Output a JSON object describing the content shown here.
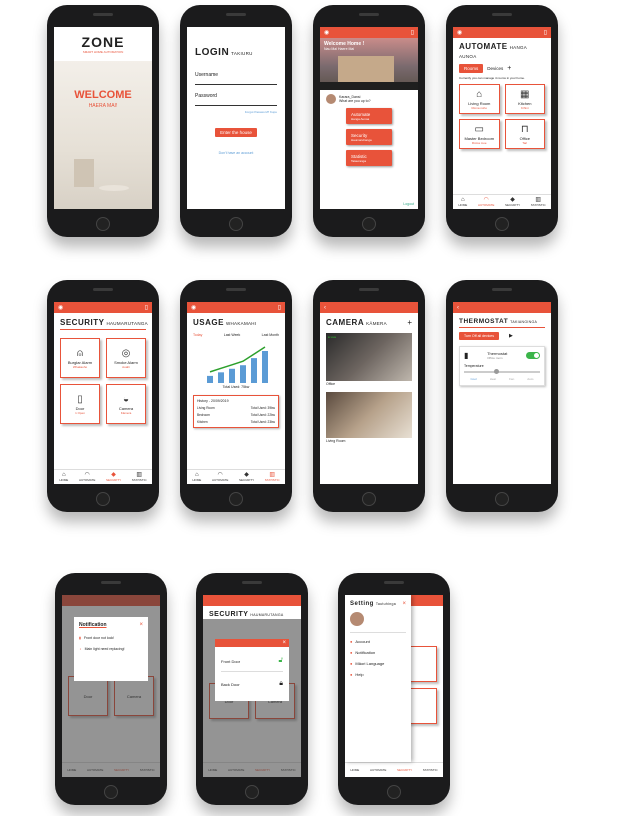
{
  "colors": {
    "accent": "#e8533a",
    "phone": "#1b1b1c"
  },
  "welcome": {
    "logo": "ZONE",
    "logo_sub": "SMART HOME AUTOMATION",
    "title": "WELCOME",
    "subtitle": "HAERA MAI!"
  },
  "login": {
    "title": "LOGIN",
    "title_sub": "TAKIURU",
    "username_label": "Username",
    "password_label": "Password",
    "forgot": "Forgot Password? Kupu",
    "enter_button": "Enter the house",
    "no_account": "Don't have an account"
  },
  "home": {
    "banner_title": "Welcome Home !",
    "banner_sub": "Nau Mai Haere Mai",
    "stats": [
      "",
      "",
      "",
      ""
    ],
    "user_name": "Karara_Dansi",
    "user_msg": "What are you up to?",
    "buttons": [
      {
        "label": "Automate",
        "sub": "Hanga Aunoa"
      },
      {
        "label": "Security",
        "sub": "Haumaruhanga"
      },
      {
        "label": "Statistic",
        "sub": "Tatauranga"
      }
    ],
    "logout": "Logout"
  },
  "automate": {
    "title": "AUTOMATE",
    "title_sub": "HANGA AUNOA",
    "tab_rooms": "Rooms",
    "tab_devices": "Devices",
    "add": "+",
    "desc": "Currently you can manage 4 rooms in your home.",
    "rooms": [
      {
        "name": "Living Room",
        "sub": "Rūma noho",
        "icon": "sofa-icon"
      },
      {
        "name": "Kitchen",
        "sub": "Kīhini",
        "icon": "kitchen-icon"
      },
      {
        "name": "Master Bedroom",
        "sub": "Rūma moe",
        "icon": "bed-icon"
      },
      {
        "name": "Office",
        "sub": "Tari",
        "icon": "desk-icon"
      }
    ]
  },
  "nav": [
    "HOME",
    "AUTOMATE",
    "SECURITY",
    "STATISTIC"
  ],
  "security": {
    "title": "SECURITY",
    "title_sub": "HAUMARUTANGA",
    "cards": [
      {
        "name": "Burglar Alarm",
        "sub": "Whakaoho",
        "icon": "alarm-icon"
      },
      {
        "name": "Smoke Alarm",
        "sub": "Auahi",
        "icon": "smoke-icon"
      },
      {
        "name": "Door",
        "sub": "1 Open",
        "icon": "door-icon"
      },
      {
        "name": "Camera",
        "sub": "Kāmera",
        "icon": "camera-icon"
      }
    ]
  },
  "usage": {
    "title": "USAGE",
    "title_sub": "WHAKAMAHI",
    "tabs": [
      "Today",
      "Last Week",
      "Last Month"
    ],
    "total": "Total Used: 75kw",
    "history_title": "History - 20/09/2019",
    "rows": [
      {
        "room": "Living Room",
        "used": "Total Used: 39kw"
      },
      {
        "room": "Bedroom",
        "used": "Total Used: 22kw"
      },
      {
        "room": "Kitchen",
        "used": "Total Used: 23kw"
      }
    ],
    "chart_values": [
      2,
      3,
      4,
      5,
      7,
      9
    ]
  },
  "camera": {
    "title": "CAMERA",
    "title_sub": "KĀMERA",
    "add": "+",
    "feeds": [
      {
        "label": "Office",
        "tag": "● Live"
      },
      {
        "label": "Living Room",
        "tag": ""
      }
    ]
  },
  "thermostat": {
    "title": "THERMOSTAT",
    "title_sub": "TAKIANGINGA",
    "off_button": "Turn Off all devices",
    "device": "Thermostat",
    "device_sub": "Office room",
    "temp_label": "Temperature",
    "modes": [
      "Cool",
      "Heat",
      "Fan",
      "Auto"
    ]
  },
  "notification": {
    "title": "Notification",
    "close": "×",
    "items": [
      "Front door not lock!",
      "Main light need replacing!"
    ]
  },
  "security2": {
    "title": "SECURITY",
    "title_sub": "HAUMARUTANGA",
    "close": "×",
    "doors": [
      {
        "name": "Front Door",
        "state": "unlocked"
      },
      {
        "name": "Back Door",
        "state": "locked"
      }
    ]
  },
  "settings": {
    "title": "Setting",
    "title_sub": "Tautuhinga",
    "close": "×",
    "items": [
      "Account",
      "Notification",
      "Māori Language",
      "Help"
    ]
  }
}
